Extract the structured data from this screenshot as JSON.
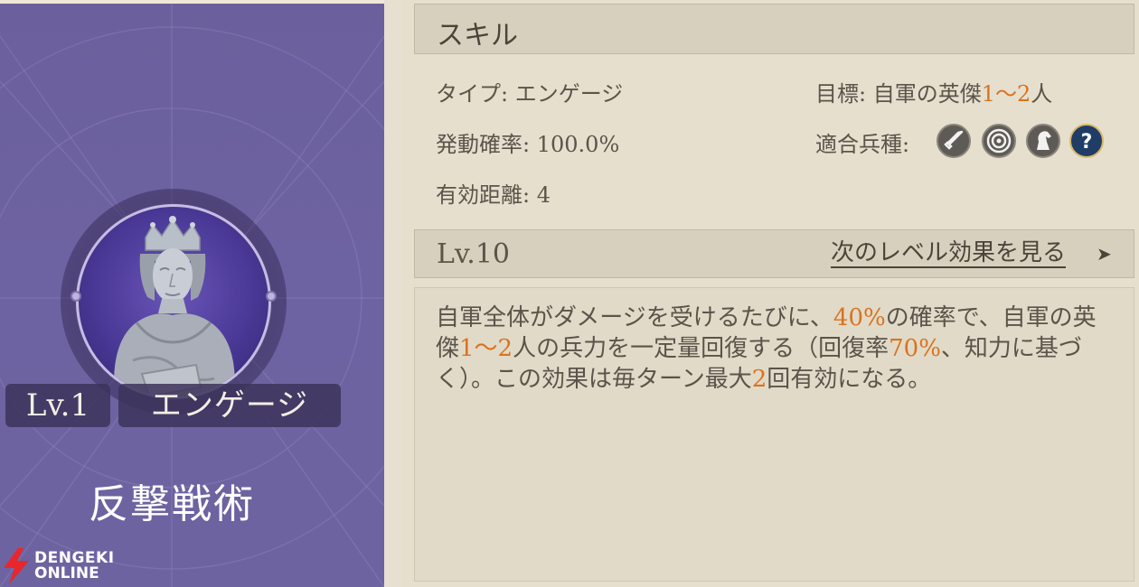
{
  "left_card": {
    "level": "Lv.1",
    "skill_type": "エンゲージ",
    "skill_name": "反撃戦術",
    "portrait": "king-statue-portrait",
    "background_color": "#6d63a0"
  },
  "watermark": {
    "line1": "DENGEKI",
    "line2": "ONLINE",
    "accent_color": "#e8262b"
  },
  "skill_panel": {
    "title": "スキル",
    "type_label": "タイプ:",
    "type_value": "エンゲージ",
    "target_label": "目標:",
    "target_prefix": "自軍の英傑",
    "target_range": "1～2",
    "target_suffix": "人",
    "rate_label": "発動確率:",
    "rate_value": "100.0%",
    "units_label": "適合兵種:",
    "units": [
      "sword-icon",
      "target-icon",
      "horse-icon",
      "question-icon"
    ],
    "range_label": "有効距離:",
    "range_value": "4"
  },
  "level_bar": {
    "level": "Lv.10",
    "next_link": "次のレベル効果を見る",
    "arrow": "➤"
  },
  "description": {
    "p1": "自軍全体がダメージを受けるたびに、",
    "h1": "40%",
    "p2": "の確率で、自軍の英傑",
    "h2": "1～2",
    "p3": "人の兵力を一定量回復する（回復率",
    "h3": "70%",
    "p4": "、知力に基づく）。この効果は毎ターン最大",
    "h4": "2",
    "p5": "回有効になる。"
  },
  "colors": {
    "highlight": "#d9731f",
    "text": "#5a544a",
    "panel_bg": "#e6dfce"
  }
}
